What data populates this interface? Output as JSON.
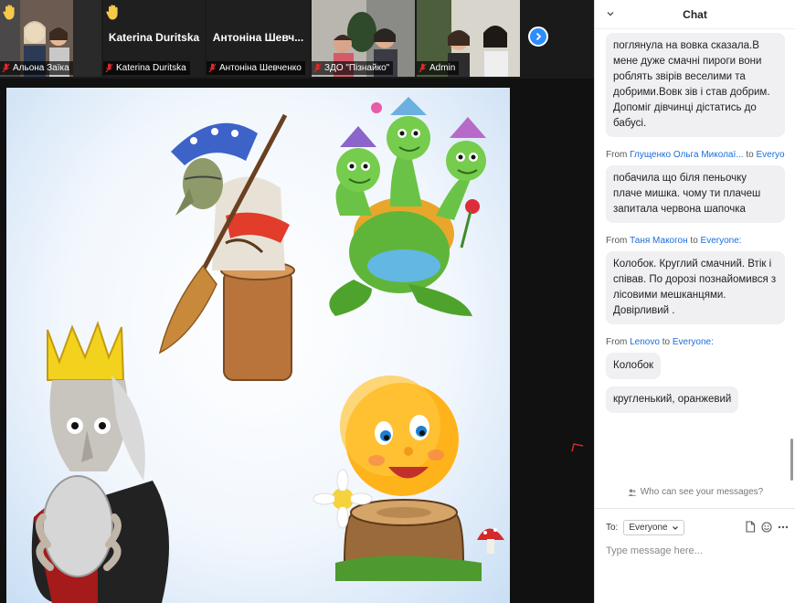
{
  "participants": [
    {
      "name": "Альона Заїка",
      "kind": "video",
      "hand": true
    },
    {
      "name": "Katerina Duritska",
      "display": "Katerina Duritska",
      "kind": "name",
      "hand": true
    },
    {
      "name": "Антоніна Шевченко",
      "display": "Антоніна Шевч...",
      "kind": "name",
      "hand": false
    },
    {
      "name": "ЗДО \"Пізнайко\"",
      "kind": "video",
      "hand": false
    },
    {
      "name": "Admin",
      "kind": "video",
      "hand": false
    }
  ],
  "chat": {
    "title": "Chat",
    "messages": [
      {
        "from": "",
        "to": "",
        "text": "поглянула на вовка сказала.В мене дуже смачні пироги вони роблять звірів веселими та добрими.Вовк зів і став добрим. Допоміг дівчинці дістатись до бабусі."
      },
      {
        "from": "Глущенко Ольга Миколаї...",
        "to": "Everyone:",
        "text": "побачила що біля пеньочку плаче мишка. чому ти плачеш запитала червона шапочка"
      },
      {
        "from": "Таня Макогон",
        "to": "Everyone:",
        "text": "Колобок. Круглий смачний. Втік і співав. По дорозі познайомився з лісовими мешканцями. Довірливий ."
      },
      {
        "from": "Lenovo",
        "to": "Everyone:",
        "text": "Колобок"
      },
      {
        "from": "",
        "to": "",
        "text": "кругленький, оранжевий"
      }
    ],
    "from_label": "From",
    "to_label": "to",
    "privacy_note": "Who can see your messages?",
    "to_field_label": "To:",
    "recipient": "Everyone",
    "input_placeholder": "Type message here..."
  },
  "colors": {
    "accent": "#2d8cff",
    "link": "#1b6ddb",
    "mic_muted": "#e02828",
    "hand": "#f7c948"
  }
}
